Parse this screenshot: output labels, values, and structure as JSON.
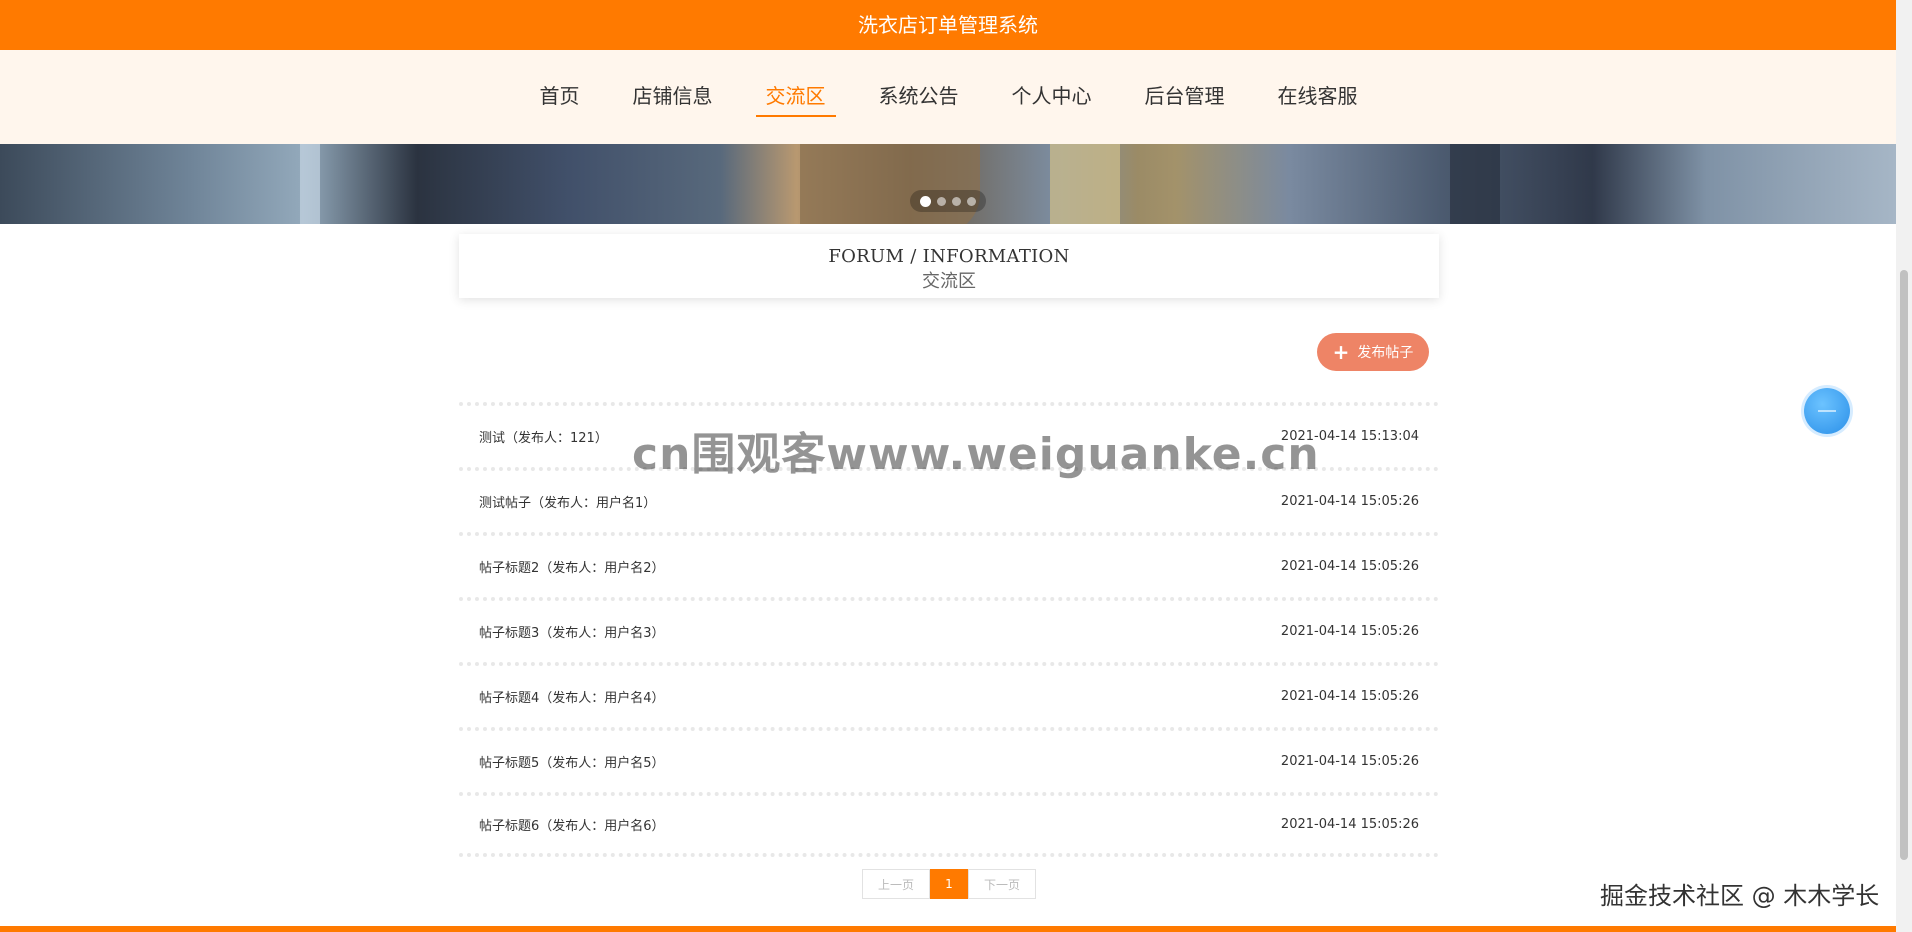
{
  "header": {
    "title": "洗衣店订单管理系统"
  },
  "nav": {
    "items": [
      {
        "label": "首页"
      },
      {
        "label": "店铺信息"
      },
      {
        "label": "交流区"
      },
      {
        "label": "系统公告"
      },
      {
        "label": "个人中心"
      },
      {
        "label": "后台管理"
      },
      {
        "label": "在线客服"
      }
    ],
    "active_index": 2
  },
  "carousel": {
    "slide_count": 4,
    "active_slide": 1
  },
  "section": {
    "title_en": "FORUM / INFORMATION",
    "title_zh": "交流区"
  },
  "actions": {
    "post_label": "发布帖子"
  },
  "posts": [
    {
      "title": "测试（发布人：121）",
      "time": "2021-04-14 15:13:04"
    },
    {
      "title": "测试帖子（发布人：用户名1）",
      "time": "2021-04-14 15:05:26"
    },
    {
      "title": "帖子标题2（发布人：用户名2）",
      "time": "2021-04-14 15:05:26"
    },
    {
      "title": "帖子标题3（发布人：用户名3）",
      "time": "2021-04-14 15:05:26"
    },
    {
      "title": "帖子标题4（发布人：用户名4）",
      "time": "2021-04-14 15:05:26"
    },
    {
      "title": "帖子标题5（发布人：用户名5）",
      "time": "2021-04-14 15:05:26"
    },
    {
      "title": "帖子标题6（发布人：用户名6）",
      "time": "2021-04-14 15:05:26"
    }
  ],
  "pagination": {
    "prev_label": "上一页",
    "current": "1",
    "next_label": "下一页"
  },
  "overlay": {
    "watermark": "cn围观客www.weiguanke.cn",
    "credit": "掘金技术社区 @ 木木学长"
  },
  "colors": {
    "accent": "#ff7a00",
    "nav_bg": "#fff6ed",
    "post_button": "#ee8466"
  }
}
